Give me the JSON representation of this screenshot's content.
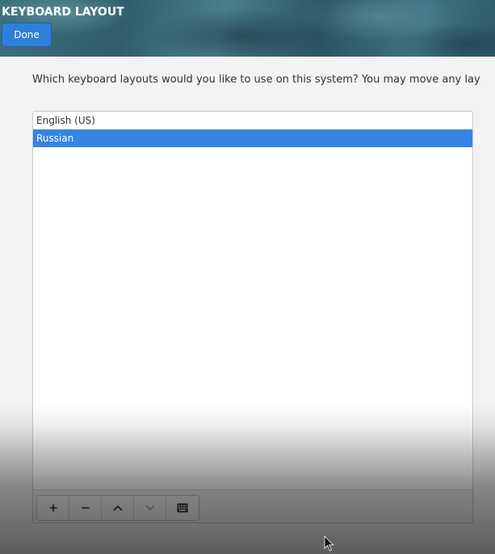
{
  "header": {
    "title": "KEYBOARD LAYOUT",
    "done_label": "Done"
  },
  "instructions": "Which keyboard layouts would you like to use on this system?  You may move any lay",
  "layouts": [
    {
      "label": "English (US)",
      "selected": false
    },
    {
      "label": "Russian",
      "selected": true
    }
  ],
  "toolbar": {
    "buttons": [
      {
        "icon": "plus-icon"
      },
      {
        "icon": "minus-icon"
      },
      {
        "icon": "chevron-up-icon"
      },
      {
        "icon": "chevron-down-icon"
      },
      {
        "icon": "keyboard-icon"
      }
    ]
  },
  "colors": {
    "accent": "#3584e4",
    "done_button": "#2f7fd8",
    "background": "#f3f3f2"
  }
}
